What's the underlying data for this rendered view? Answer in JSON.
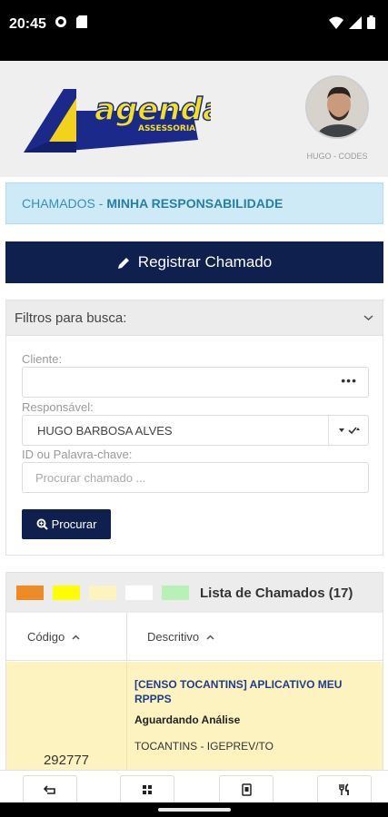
{
  "status_bar": {
    "time": "20:45",
    "left_icons": [
      "gear-icon",
      "sd-card-icon"
    ],
    "right_icons": [
      "wifi-icon",
      "signal-icon",
      "battery-icon"
    ]
  },
  "header": {
    "logo_text_main": "agenda",
    "logo_text_sub": "ASSESSORIA",
    "user_name": "HUGO - CODES"
  },
  "page_title": {
    "prefix": "CHAMADOS",
    "separator": " - ",
    "title": "MINHA RESPONSABILIDADE"
  },
  "register_button": {
    "label": "Registrar Chamado",
    "icon": "pencil-icon"
  },
  "filters": {
    "heading": "Filtros para busca:",
    "client_label": "Cliente:",
    "client_value": "",
    "client_ellipsis": "•••",
    "responsible_label": "Responsável:",
    "responsible_value": "HUGO BARBOSA ALVES",
    "keyword_label": "ID ou Palavra-chave:",
    "keyword_placeholder": "Procurar chamado ...",
    "search_button": "Procurar"
  },
  "list": {
    "title": "Lista de Chamados (17)",
    "legend_colors": [
      "#f08a24",
      "#ffff00",
      "#fdf3c0",
      "#ffffff",
      "#b8f0b8"
    ],
    "columns": [
      "Código",
      "Descritivo"
    ],
    "rows": [
      {
        "code": "292777",
        "title": "[CENSO TOCANTINS] APLICATIVO MEU RPPPS",
        "status": "Aguardando Análise",
        "client": "TOCANTINS - IGEPREV/TO",
        "row_color": "#fdf3c0"
      }
    ]
  },
  "colors": {
    "navy": "#0f1f4e",
    "title_bg": "#cdeaf6",
    "title_text": "#2a7ea1"
  },
  "bottom_bar": [
    "back-icon",
    "grid-icon",
    "document-icon",
    "utensils-icon"
  ]
}
